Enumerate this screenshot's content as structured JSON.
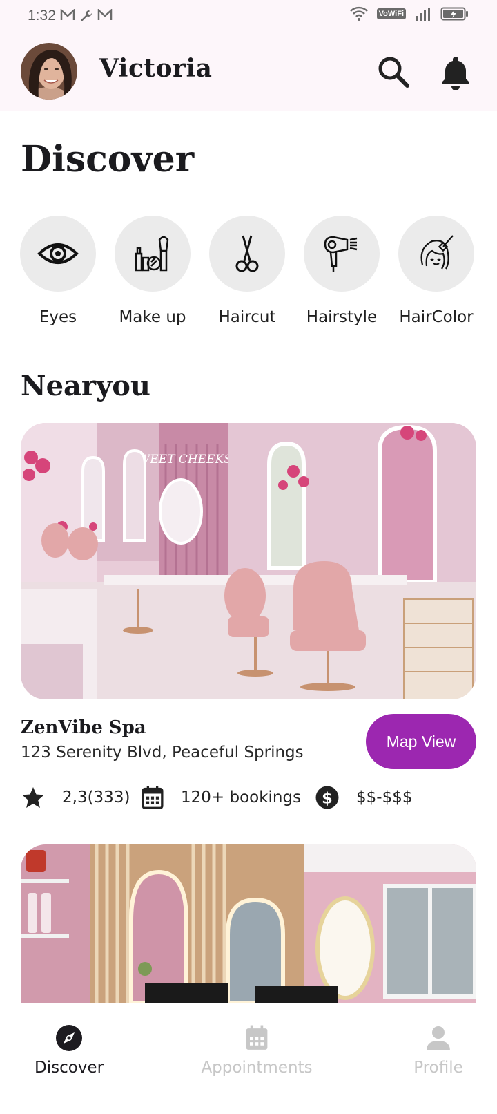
{
  "status_bar": {
    "time": "1:32",
    "vowifi": "VoWiFi"
  },
  "header": {
    "user_name": "Victoria"
  },
  "page_title": "Discover",
  "categories": [
    {
      "label": "Eyes",
      "icon": "eye-icon"
    },
    {
      "label": "Make up",
      "icon": "makeup-icon"
    },
    {
      "label": "Haircut",
      "icon": "scissors-icon"
    },
    {
      "label": "Hairstyle",
      "icon": "hairdryer-icon"
    },
    {
      "label": "HairColor",
      "icon": "haircolor-icon"
    }
  ],
  "near_you": {
    "title": "Nearyou",
    "salons": [
      {
        "name": "ZenVibe Spa",
        "address": "123 Serenity Blvd, Peaceful Springs",
        "rating": "2,3(333)",
        "bookings": "120+ bookings",
        "price": "$$-$$$",
        "map_label": "Map View",
        "image_text": "SWEET CHEEKS"
      }
    ]
  },
  "bottom_nav": [
    {
      "label": "Discover",
      "active": true
    },
    {
      "label": "Appointments",
      "active": false
    },
    {
      "label": "Profile",
      "active": false
    }
  ],
  "colors": {
    "accent": "#9c27b0",
    "header_bg": "#fdf6fa",
    "chip_bg": "#ebebeb"
  }
}
